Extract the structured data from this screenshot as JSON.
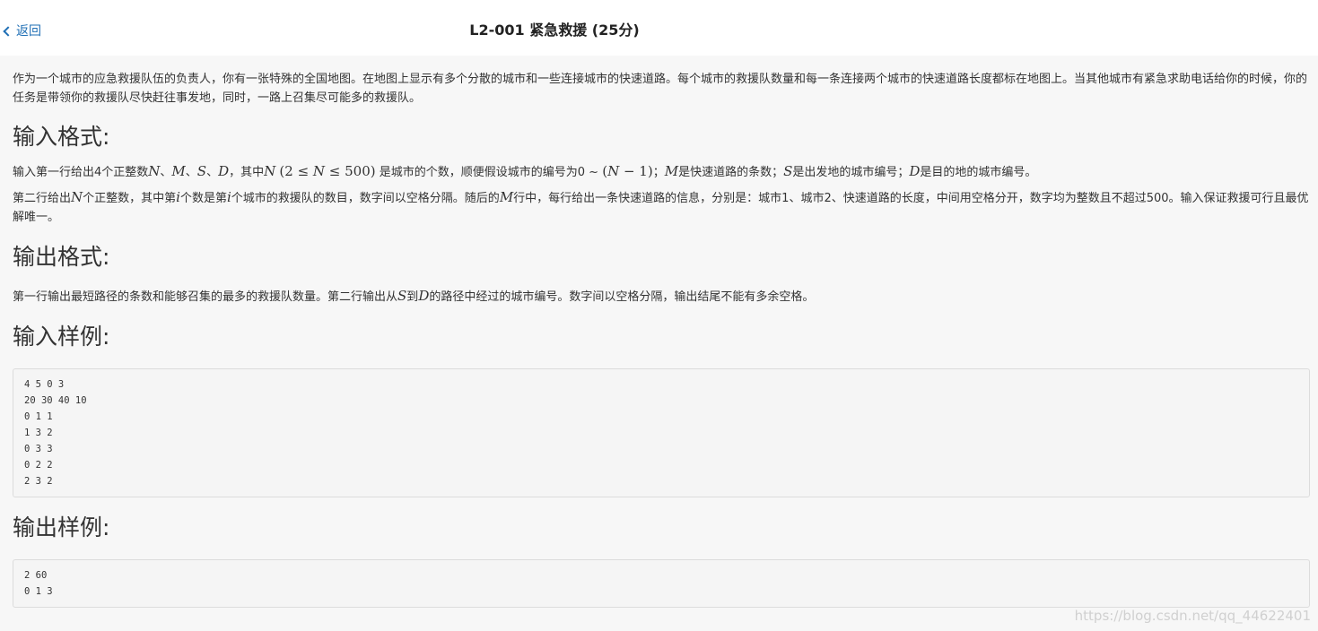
{
  "header": {
    "back_label": "返回",
    "title": "L2-001 紧急救援 (25分)"
  },
  "description": "作为一个城市的应急救援队伍的负责人，你有一张特殊的全国地图。在地图上显示有多个分散的城市和一些连接城市的快速道路。每个城市的救援队数量和每一条连接两个城市的快速道路长度都标在地图上。当其他城市有紧急求助电话给你的时候，你的任务是带领你的救援队尽快赶往事发地，同时，一路上召集尽可能多的救援队。",
  "input_format": {
    "heading": "输入格式:",
    "line1": {
      "t1": "输入第一行给出4个正整数",
      "m1": "N",
      "t2": "、",
      "m2": "M",
      "t3": "、",
      "m3": "S",
      "t4": "、",
      "m4": "D",
      "t5": "，其中",
      "m5": "N",
      "m6": "(2 ≤ ",
      "m7": "N",
      "m8": " ≤ 500)",
      "t6": "是城市的个数，顺便假设城市的编号为0 ~ ",
      "m9": "(",
      "m10": "N",
      "m11": " − 1)",
      "t7": "；",
      "m12": "M",
      "t8": "是快速道路的条数；",
      "m13": "S",
      "t9": "是出发地的城市编号；",
      "m14": "D",
      "t10": "是目的地的城市编号。"
    },
    "line2": {
      "t1": "第二行给出",
      "m1": "N",
      "t2": "个正整数，其中第",
      "m2": "i",
      "t3": "个数是第",
      "m3": "i",
      "t4": "个城市的救援队的数目，数字间以空格分隔。随后的",
      "m4": "M",
      "t5": "行中，每行给出一条快速道路的信息，分别是：城市1、城市2、快速道路的长度，中间用空格分开，数字均为整数且不超过500。输入保证救援可行且最优解唯一。"
    }
  },
  "output_format": {
    "heading": "输出格式:",
    "line": {
      "t1": "第一行输出最短路径的条数和能够召集的最多的救援队数量。第二行输出从",
      "m1": "S",
      "t2": "到",
      "m2": "D",
      "t3": "的路径中经过的城市编号。数字间以空格分隔，输出结尾不能有多余空格。"
    }
  },
  "sample_input": {
    "heading": "输入样例:",
    "code": "4 5 0 3\n20 30 40 10\n0 1 1\n1 3 2\n0 3 3\n0 2 2\n2 3 2"
  },
  "sample_output": {
    "heading": "输出样例:",
    "code": "2 60\n0 1 3"
  },
  "watermark": "https://blog.csdn.net/qq_44622401",
  "colors": {
    "link": "#1f6fb5",
    "background": "#f7f7f7",
    "header_bg": "#ffffff"
  },
  "icons": {
    "back": "chevron-left-icon"
  }
}
